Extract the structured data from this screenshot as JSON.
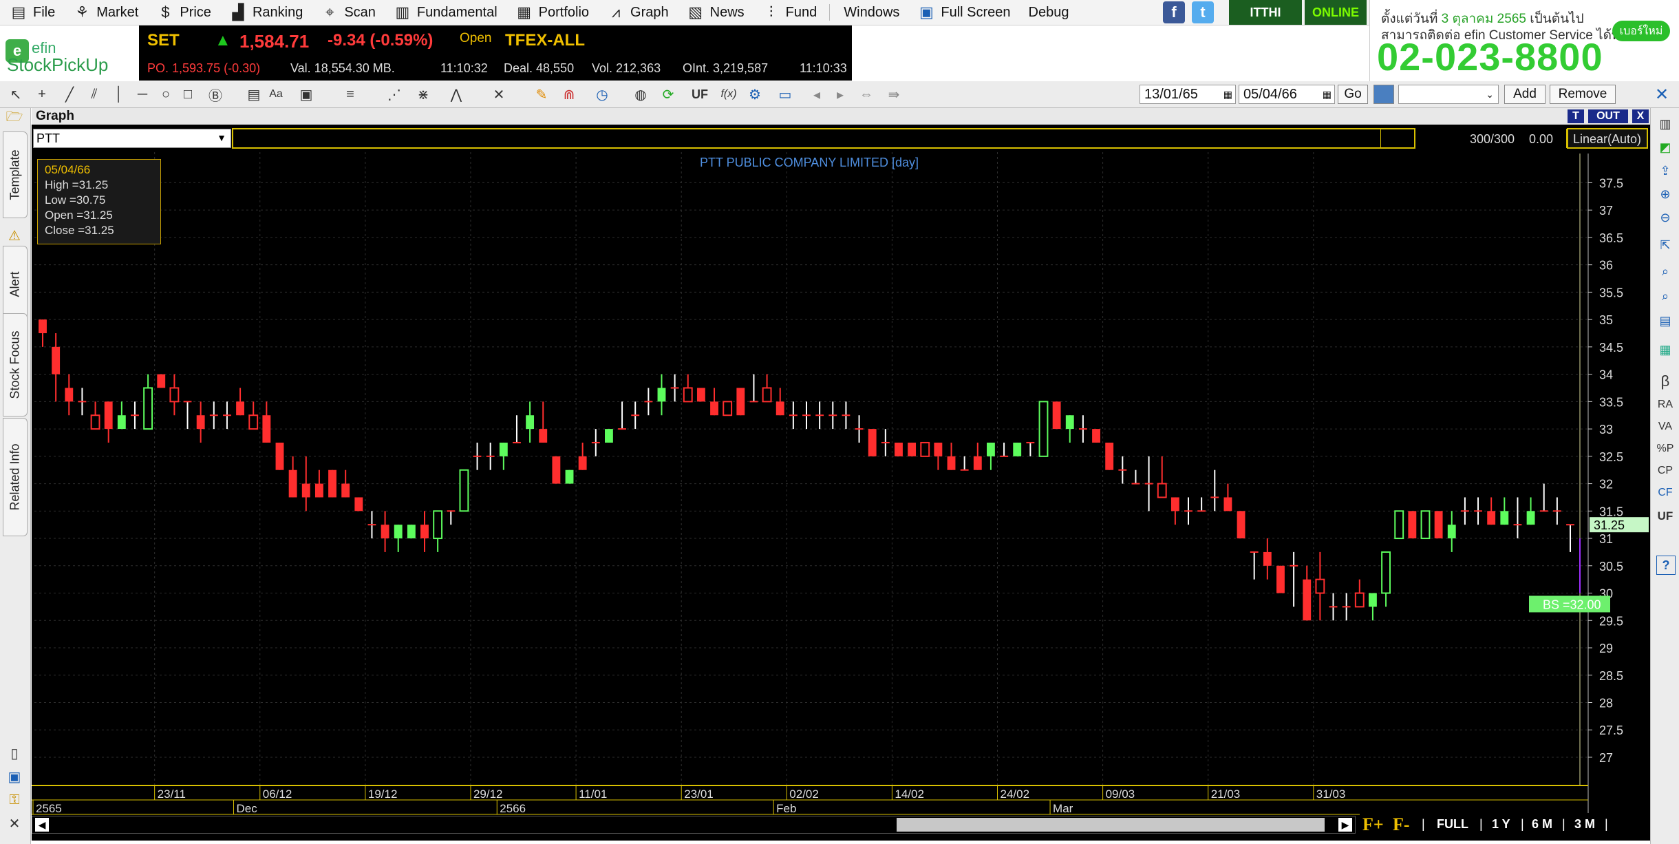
{
  "menu": {
    "items": [
      {
        "label": "File",
        "icon": "file-icon"
      },
      {
        "label": "Market",
        "icon": "market-icon"
      },
      {
        "label": "Price",
        "icon": "dollar-icon"
      },
      {
        "label": "Ranking",
        "icon": "ranking-icon"
      },
      {
        "label": "Scan",
        "icon": "scan-icon"
      },
      {
        "label": "Fundamental",
        "icon": "fundamental-icon"
      },
      {
        "label": "Portfolio",
        "icon": "portfolio-icon"
      },
      {
        "label": "Graph",
        "icon": "graph-icon"
      },
      {
        "label": "News",
        "icon": "news-icon"
      },
      {
        "label": "Fund",
        "icon": "fund-icon"
      },
      {
        "label": "Windows",
        "icon": ""
      },
      {
        "label": "Full Screen",
        "icon": "fullscreen-icon"
      },
      {
        "label": "Debug",
        "icon": ""
      }
    ],
    "ithi": "ITTHI",
    "online": "ONLINE"
  },
  "ad": {
    "line1_prefix": "ตั้งแต่วันที่ ",
    "line1_date": "3 ตุลาคม 2565",
    "line1_suffix": " เป็นต้นไป",
    "line2": "สามารถติดต่อ efin Customer Service ได้ที่",
    "phone": "02-023-8800",
    "pill": "เบอร์ใหม่"
  },
  "logo": {
    "top": "efin",
    "bottom": "StockPickUp"
  },
  "ticker": {
    "set_label": "SET",
    "set_value": "1,584.71",
    "set_change": "-9.34 (-0.59%)",
    "status": "Open",
    "po": "PO. 1,593.75 (-0.30)",
    "val": "Val. 18,554.30 MB.",
    "time1": "11:10:32",
    "tfex": "TFEX-ALL",
    "deal": "Deal. 48,550",
    "vol": "Vol. 212,363",
    "oint": "OInt. 3,219,587",
    "time2": "11:10:33"
  },
  "toolbar": {
    "date_from": "13/01/65",
    "date_to": "05/04/66",
    "go": "Go",
    "add": "Add",
    "remove": "Remove",
    "uf": "UF",
    "fx": "f(x)"
  },
  "left_tabs": [
    "Template",
    "Alert",
    "Stock Focus",
    "Related Info"
  ],
  "right_tools": [
    "β",
    "RA",
    "VA",
    "%P",
    "CP",
    "CF",
    "UF"
  ],
  "graph": {
    "header_title": "Graph",
    "btn_t": "T",
    "btn_out": "OUT",
    "btn_x": "X",
    "symbol": "PTT",
    "count": "300/300",
    "zero": "0.00",
    "scale": "Linear(Auto)",
    "chart_title": "PTT PUBLIC COMPANY LIMITED [day]",
    "info": {
      "date": "05/04/66",
      "high": "High  =31.25",
      "low": "Low   =30.75",
      "open": "Open  =31.25",
      "close": "Close  =31.25"
    },
    "price_tag": "31.25",
    "bs_tag": "BS =32.00",
    "bottom_buttons": [
      "F+",
      "F-",
      "FULL",
      "1 Y",
      "6 M",
      "3 M"
    ]
  },
  "chart_data": {
    "type": "candlestick",
    "title": "PTT PUBLIC COMPANY LIMITED [day]",
    "ylim": [
      27,
      37.5
    ],
    "y_ticks": [
      27,
      27.5,
      28,
      28.5,
      29,
      29.5,
      30,
      30.5,
      31,
      31.5,
      32,
      32.5,
      33,
      33.5,
      34,
      34.5,
      35,
      35.5,
      36,
      36.5,
      37,
      37.5
    ],
    "x_ticks": [
      "23/11",
      "06/12",
      "19/12",
      "29/12",
      "11/01",
      "23/01",
      "02/02",
      "14/02",
      "24/02",
      "09/03",
      "21/03",
      "31/03"
    ],
    "x_tick_index": [
      9,
      17,
      25,
      33,
      41,
      49,
      57,
      65,
      73,
      81,
      89,
      97
    ],
    "period_labels": [
      "2565",
      "Dec",
      "2566",
      "Feb",
      "Mar"
    ],
    "period_index": [
      0,
      15,
      35,
      56,
      77
    ],
    "candles": [
      [
        35,
        35,
        34.5,
        34.75
      ],
      [
        34.5,
        34.75,
        33.5,
        34
      ],
      [
        33.75,
        34,
        33.25,
        33.5
      ],
      [
        33.5,
        33.75,
        33.25,
        33.5
      ],
      [
        33.25,
        33.5,
        33,
        33
      ],
      [
        33.5,
        33.5,
        32.75,
        33
      ],
      [
        33,
        33.5,
        33,
        33.25
      ],
      [
        33.25,
        33.5,
        33,
        33.25
      ],
      [
        33,
        34,
        33,
        33.75
      ],
      [
        34,
        34,
        33.75,
        33.75
      ],
      [
        33.75,
        34,
        33.25,
        33.5
      ],
      [
        33.5,
        33.5,
        33,
        33.5
      ],
      [
        33.25,
        33.5,
        32.75,
        33
      ],
      [
        33.25,
        33.5,
        33,
        33.25
      ],
      [
        33.25,
        33.5,
        33,
        33.25
      ],
      [
        33.5,
        33.75,
        33.25,
        33.25
      ],
      [
        33.25,
        33.5,
        33,
        33
      ],
      [
        33.25,
        33.5,
        32.75,
        32.75
      ],
      [
        32.75,
        32.75,
        32.25,
        32.25
      ],
      [
        32.25,
        32.5,
        31.75,
        31.75
      ],
      [
        32,
        32.5,
        31.5,
        31.75
      ],
      [
        32,
        32.25,
        31.75,
        31.75
      ],
      [
        32.25,
        32.25,
        31.75,
        31.75
      ],
      [
        32,
        32.25,
        31.75,
        31.75
      ],
      [
        31.75,
        31.75,
        31.5,
        31.5
      ],
      [
        31.25,
        31.5,
        31,
        31.25
      ],
      [
        31.25,
        31.5,
        30.75,
        31
      ],
      [
        31,
        31.25,
        30.75,
        31.25
      ],
      [
        31,
        31.25,
        31,
        31.25
      ],
      [
        31.25,
        31.5,
        30.75,
        31
      ],
      [
        31,
        31.5,
        30.75,
        31.5
      ],
      [
        31.5,
        31.5,
        31.25,
        31.5
      ],
      [
        31.5,
        32.25,
        31.5,
        32.25
      ],
      [
        32.5,
        32.75,
        32.25,
        32.5
      ],
      [
        32.5,
        32.75,
        32.25,
        32.5
      ],
      [
        32.5,
        32.75,
        32.25,
        32.75
      ],
      [
        32.75,
        33.25,
        32.75,
        32.75
      ],
      [
        33,
        33.5,
        32.75,
        33.25
      ],
      [
        33,
        33.5,
        32.75,
        32.75
      ],
      [
        32.5,
        32.5,
        32,
        32
      ],
      [
        32,
        32.25,
        32,
        32.25
      ],
      [
        32.5,
        32.75,
        32.25,
        32.25
      ],
      [
        32.75,
        33,
        32.5,
        32.75
      ],
      [
        32.75,
        33,
        32.75,
        33
      ],
      [
        33,
        33.5,
        33,
        33
      ],
      [
        33.25,
        33.5,
        33,
        33.25
      ],
      [
        33.5,
        33.75,
        33.25,
        33.5
      ],
      [
        33.5,
        34,
        33.25,
        33.75
      ],
      [
        33.75,
        34,
        33.5,
        33.75
      ],
      [
        33.75,
        34,
        33.5,
        33.5
      ],
      [
        33.75,
        33.75,
        33.5,
        33.5
      ],
      [
        33.5,
        33.75,
        33.25,
        33.25
      ],
      [
        33.5,
        33.5,
        33.25,
        33.25
      ],
      [
        33.75,
        33.75,
        33.25,
        33.25
      ],
      [
        33.5,
        34,
        33.5,
        33.5
      ],
      [
        33.75,
        34,
        33.5,
        33.5
      ],
      [
        33.5,
        33.75,
        33.25,
        33.25
      ],
      [
        33.25,
        33.5,
        33,
        33.25
      ],
      [
        33.25,
        33.5,
        33,
        33.25
      ],
      [
        33.25,
        33.5,
        33,
        33.25
      ],
      [
        33.25,
        33.5,
        33,
        33.25
      ],
      [
        33.25,
        33.5,
        33,
        33.25
      ],
      [
        33,
        33.25,
        32.75,
        33
      ],
      [
        33,
        33,
        32.5,
        32.5
      ],
      [
        32.75,
        33,
        32.5,
        32.75
      ],
      [
        32.75,
        32.75,
        32.5,
        32.5
      ],
      [
        32.75,
        32.75,
        32.5,
        32.5
      ],
      [
        32.75,
        32.75,
        32.5,
        32.5
      ],
      [
        32.75,
        32.75,
        32.25,
        32.5
      ],
      [
        32.5,
        32.75,
        32.25,
        32.25
      ],
      [
        32.25,
        32.5,
        32.25,
        32.25
      ],
      [
        32.5,
        32.75,
        32.25,
        32.25
      ],
      [
        32.5,
        32.75,
        32.25,
        32.75
      ],
      [
        32.5,
        32.75,
        32.5,
        32.5
      ],
      [
        32.5,
        32.75,
        32.5,
        32.75
      ],
      [
        32.75,
        32.75,
        32.5,
        32.75
      ],
      [
        32.5,
        33.5,
        32.5,
        33.5
      ],
      [
        33.5,
        33.5,
        33,
        33
      ],
      [
        33,
        33.25,
        32.75,
        33.25
      ],
      [
        33,
        33.25,
        32.75,
        33
      ],
      [
        33,
        33,
        32.75,
        32.75
      ],
      [
        32.75,
        32.75,
        32.25,
        32.25
      ],
      [
        32.25,
        32.5,
        32,
        32.25
      ],
      [
        32,
        32.25,
        32,
        32
      ],
      [
        32,
        32.5,
        31.5,
        32
      ],
      [
        32,
        32.5,
        31.75,
        31.75
      ],
      [
        31.75,
        31.75,
        31.25,
        31.5
      ],
      [
        31.5,
        31.75,
        31.25,
        31.5
      ],
      [
        31.5,
        31.75,
        31.5,
        31.5
      ],
      [
        31.75,
        32.25,
        31.5,
        31.75
      ],
      [
        31.75,
        32,
        31.5,
        31.5
      ],
      [
        31.5,
        31.5,
        31,
        31
      ],
      [
        30.75,
        30.75,
        30.25,
        30.75
      ],
      [
        30.75,
        31,
        30.25,
        30.5
      ],
      [
        30.5,
        30.5,
        30,
        30
      ],
      [
        30.5,
        30.75,
        29.75,
        30.5
      ],
      [
        30.25,
        30.5,
        29.5,
        29.5
      ],
      [
        30.25,
        30.75,
        29.5,
        30
      ],
      [
        29.75,
        30,
        29.5,
        29.75
      ],
      [
        29.75,
        30,
        29.5,
        29.75
      ],
      [
        30,
        30.25,
        29.75,
        29.75
      ],
      [
        29.75,
        30,
        29.5,
        30
      ],
      [
        30,
        30.75,
        29.75,
        30.75
      ],
      [
        31,
        31.5,
        31,
        31.5
      ],
      [
        31.5,
        31.5,
        31,
        31
      ],
      [
        31,
        31.5,
        31,
        31.5
      ],
      [
        31.5,
        31.5,
        31,
        31
      ],
      [
        31,
        31.5,
        30.75,
        31.25
      ],
      [
        31.5,
        31.75,
        31.25,
        31.5
      ],
      [
        31.5,
        31.75,
        31.25,
        31.5
      ],
      [
        31.5,
        31.75,
        31.25,
        31.25
      ],
      [
        31.25,
        31.75,
        31.25,
        31.5
      ],
      [
        31.25,
        31.75,
        31,
        31.25
      ],
      [
        31.25,
        31.75,
        31.25,
        31.5
      ],
      [
        31.5,
        32,
        31.5,
        31.5
      ],
      [
        31.5,
        31.75,
        31.25,
        31.5
      ],
      [
        31.25,
        31.25,
        30.75,
        31.25
      ]
    ],
    "bar_colors_note": "red when close<open, green when close>open, white when equal",
    "last_close": 31.25,
    "bs_level": 32.0
  }
}
